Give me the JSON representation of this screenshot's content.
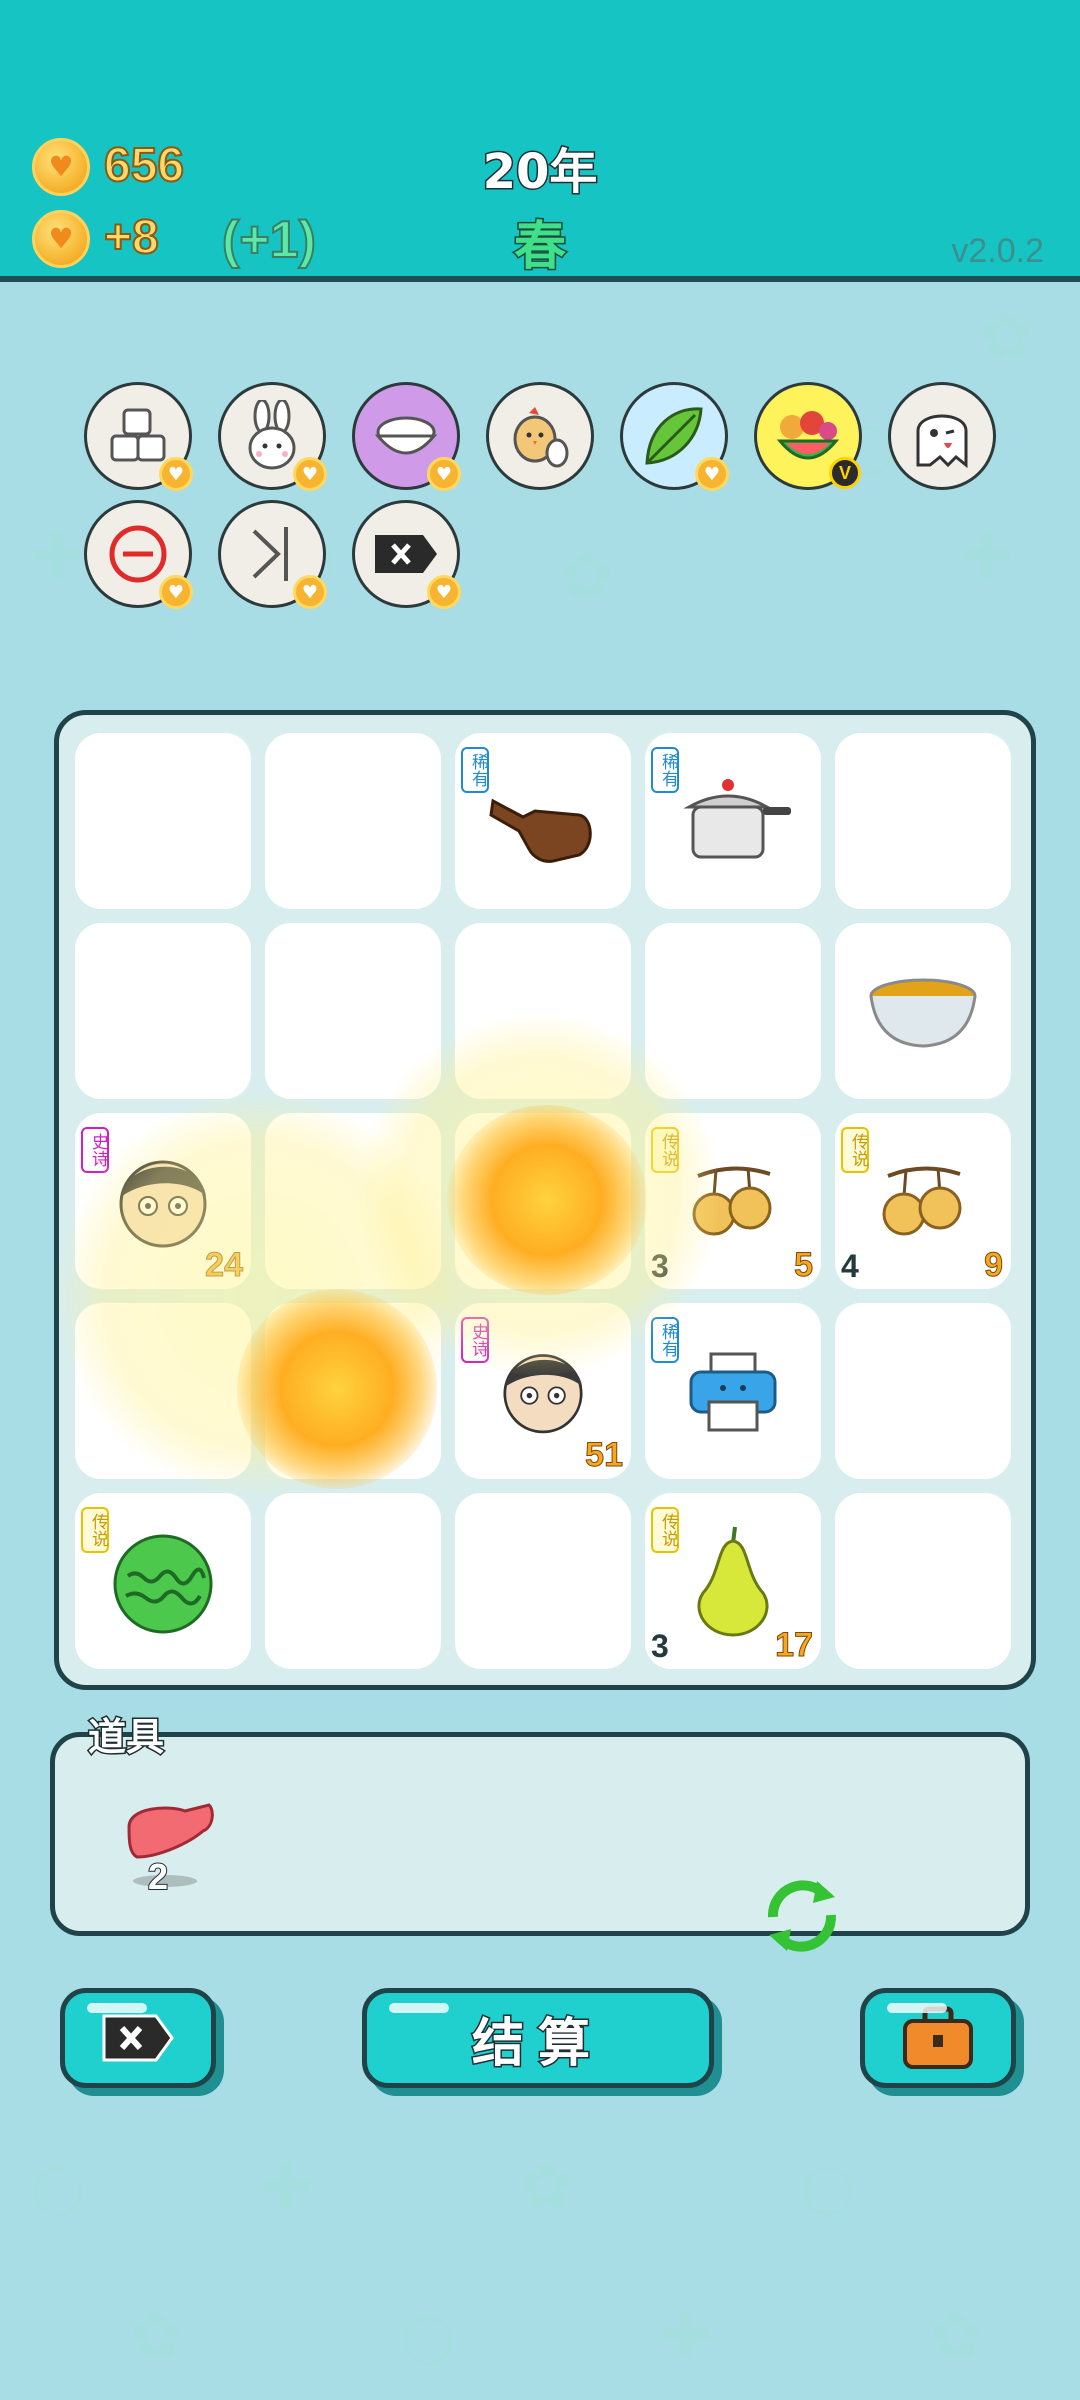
{
  "header": {
    "coins": "656",
    "income": "+8",
    "income_bonus": "(+1)",
    "year": "20年",
    "season": "春",
    "version": "v2.0.2"
  },
  "skills": [
    {
      "name": "sugar-cubes-icon"
    },
    {
      "name": "rabbit-icon"
    },
    {
      "name": "rice-bowl-icon"
    },
    {
      "name": "chick-egg-icon"
    },
    {
      "name": "leaf-icon"
    },
    {
      "name": "fruit-basket-icon",
      "vip": "V"
    },
    {
      "name": "ghost-icon"
    },
    {
      "name": "remove-icon"
    },
    {
      "name": "skip-icon"
    },
    {
      "name": "delete-tag-icon"
    }
  ],
  "tags": {
    "rare": "稀有",
    "epic": "史诗",
    "legend": "传说"
  },
  "board": {
    "r0c2": {
      "tag": "稀有",
      "icon": "pointing-hand-icon"
    },
    "r0c3": {
      "tag": "稀有",
      "icon": "pressure-cooker-icon"
    },
    "r1c4": {
      "icon": "soup-bowl-icon"
    },
    "r2c0": {
      "tag": "史诗",
      "icon": "man-face-icon",
      "value": "24"
    },
    "r2c3": {
      "tag": "传说",
      "icon": "longan-icon",
      "count": "3",
      "value": "5"
    },
    "r2c4": {
      "tag": "传说",
      "icon": "longan-icon",
      "count": "4",
      "value": "9"
    },
    "r3c2": {
      "tag": "史诗",
      "icon": "man-face-icon",
      "value": "51"
    },
    "r3c3": {
      "tag": "稀有",
      "icon": "printer-icon"
    },
    "r4c0": {
      "tag": "传说",
      "icon": "watermelon-icon"
    },
    "r4c3": {
      "tag": "传说",
      "icon": "pear-icon",
      "count": "3",
      "value": "17"
    }
  },
  "tools": {
    "title": "道具",
    "items": [
      {
        "icon": "liver-icon",
        "count": "2"
      }
    ]
  },
  "buttons": {
    "settle": "结算"
  },
  "colors": {
    "header": "#17c4c4",
    "background": "#a9dde6",
    "button": "#1fd0cf",
    "coin_text": "#ffd86b",
    "rare": "#1f8bd4",
    "epic": "#d61dc4",
    "legend": "#e8c200"
  }
}
